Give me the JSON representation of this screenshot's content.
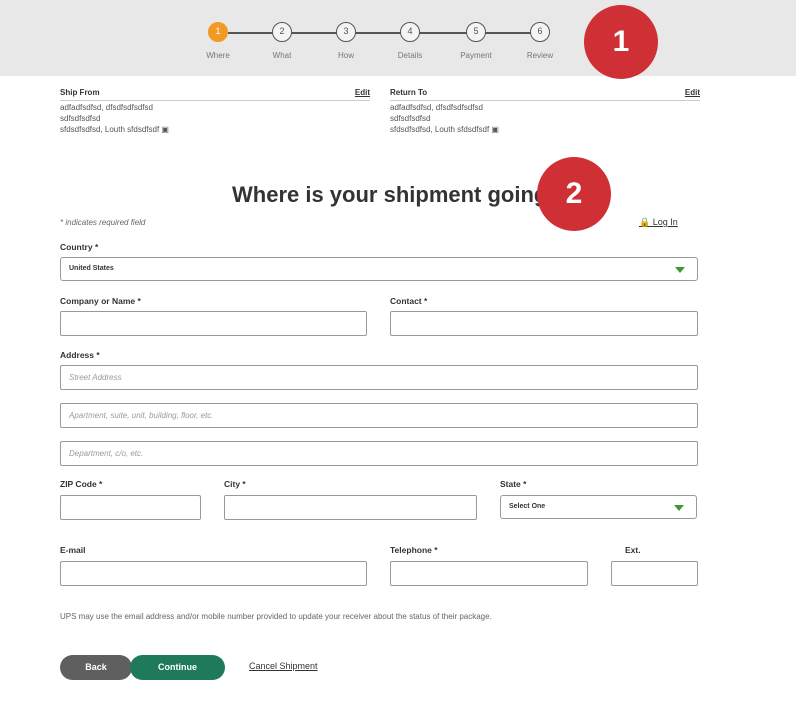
{
  "progress": {
    "steps": [
      {
        "num": "1",
        "label": "Where"
      },
      {
        "num": "2",
        "label": "What"
      },
      {
        "num": "3",
        "label": "How"
      },
      {
        "num": "4",
        "label": "Details"
      },
      {
        "num": "5",
        "label": "Payment"
      },
      {
        "num": "6",
        "label": "Review"
      }
    ],
    "active_step": 1
  },
  "badges": {
    "one": "1",
    "two": "2"
  },
  "ship_from": {
    "title": "Ship From",
    "edit": "Edit",
    "lines": [
      "adfadfsdfsd, dfsdfsdfsdfsd",
      "sdfsdfsdfsd",
      "sfdsdfsdfsd, Louth sfdsdfsdf"
    ]
  },
  "return_to": {
    "title": "Return To",
    "edit": "Edit",
    "lines": [
      "adfadfsdfsd, dfsdfsdfsdfsd",
      "sdfsdfsdfsd",
      "sfdsdfsdfsd, Louth sfdsdfsdf"
    ]
  },
  "form": {
    "title": "Where is your shipment going?",
    "required_note": "* indicates required field",
    "login": "Log In",
    "country_label": "Country *",
    "country_value": "United States",
    "company_label": "Company or Name *",
    "contact_label": "Contact *",
    "address_label": "Address *",
    "address_placeholder_1": "Street Address",
    "address_placeholder_2": "Apartment, suite, unit, building, floor, etc.",
    "address_placeholder_3": "Department, c/o, etc.",
    "zip_label": "ZIP Code *",
    "city_label": "City *",
    "state_label": "State *",
    "state_value": "Select One",
    "email_label": "E-mail",
    "phone_label": "Telephone *",
    "ext_label": "Ext.",
    "notice": "UPS may use the email address and/or mobile number provided to update your receiver about the status of their package."
  },
  "buttons": {
    "back": "Back",
    "continue": "Continue",
    "cancel": "Cancel Shipment"
  },
  "colors": {
    "active_step": "#f29a24",
    "badge": "#cf3036",
    "continue": "#1f7a5c",
    "back": "#5f5f5f",
    "dropdown_arrow": "#3c9b2f"
  }
}
